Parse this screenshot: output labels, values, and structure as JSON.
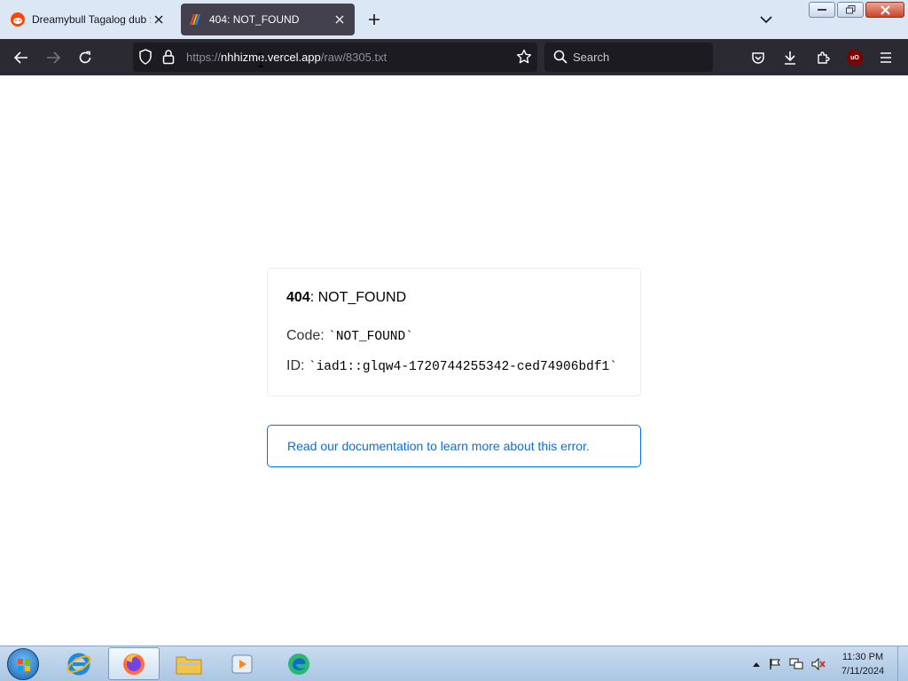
{
  "browser": {
    "tabs": [
      {
        "title": "Dreamybull Tagalog dub :",
        "active": false,
        "favicon": "reddit-icon"
      },
      {
        "title": "404: NOT_FOUND",
        "active": true,
        "favicon": "vercel-rainbow-icon"
      }
    ],
    "url": {
      "protocol": "https://",
      "host": "nhhizme.vercel.app",
      "path": "/raw/8305.txt"
    },
    "search": {
      "placeholder": "Search"
    },
    "extension_badge": "uO"
  },
  "error": {
    "status": "404",
    "message": "NOT_FOUND",
    "code_label": "Code:",
    "code_value": "`NOT_FOUND`",
    "id_label": "ID:",
    "id_value": "`iad1::glqw4-1720744255342-ced74906bdf1`",
    "doc_link": "Read our documentation to learn more about this error."
  },
  "taskbar": {
    "apps": [
      "internet-explorer-icon",
      "firefox-icon",
      "file-explorer-icon",
      "media-player-icon",
      "edge-icon"
    ],
    "time": "11:30 PM",
    "date": "7/11/2024"
  },
  "colors": {
    "tabstrip": "#dbe7f5",
    "navbar": "#2b2a33",
    "link": "#0070f3"
  }
}
